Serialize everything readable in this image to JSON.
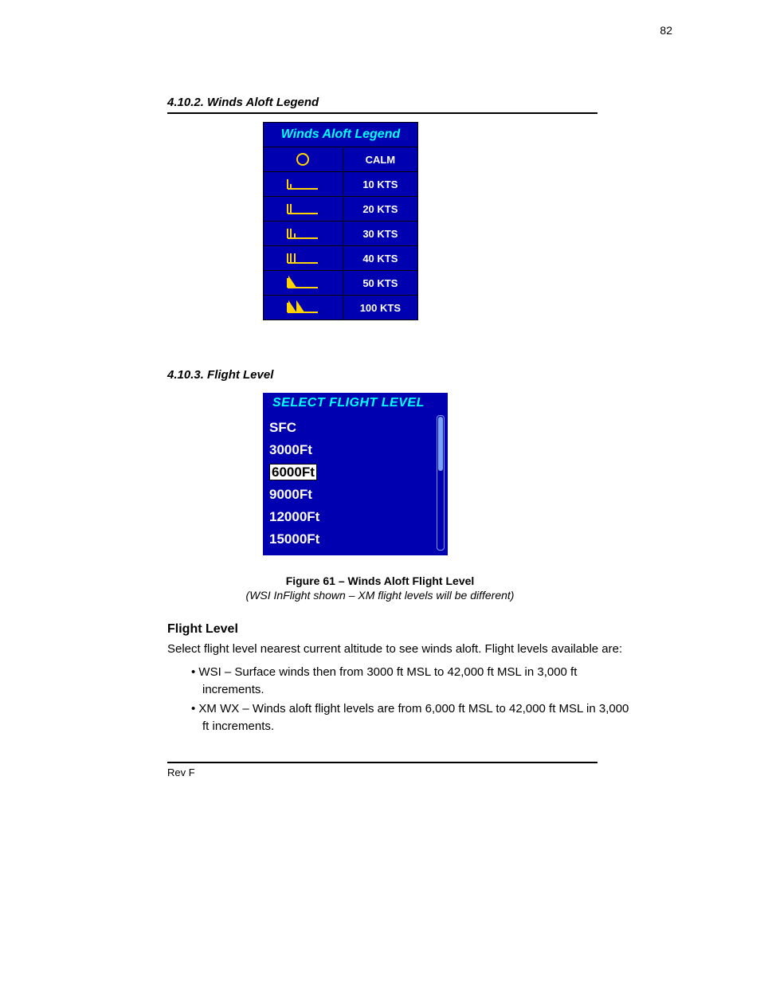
{
  "page_number": "82",
  "section_title_legend": "4.10.2. Winds Aloft Legend",
  "legend": {
    "title": "Winds Aloft Legend",
    "rows": [
      {
        "icon": "calm",
        "label": "CALM"
      },
      {
        "icon": "barb10",
        "label": "10 KTS"
      },
      {
        "icon": "barb20",
        "label": "20 KTS"
      },
      {
        "icon": "barb30",
        "label": "30 KTS"
      },
      {
        "icon": "barb40",
        "label": "40 KTS"
      },
      {
        "icon": "barb50",
        "label": "50 KTS"
      },
      {
        "icon": "barb100",
        "label": "100 KTS"
      }
    ]
  },
  "section_title_level": "4.10.3. Flight Level",
  "flight_level": {
    "title": "SELECT FLIGHT LEVEL",
    "items": [
      "SFC",
      "3000Ft",
      "6000Ft",
      "9000Ft",
      "12000Ft",
      "15000Ft"
    ],
    "selected_index": 2
  },
  "figure_caption": "Figure 61 – Winds Aloft Flight Level",
  "figure_note": "(WSI InFlight shown – XM flight levels will be different)",
  "flight_level_heading": "Flight Level",
  "flight_level_body": "Select flight level nearest current altitude to see winds aloft. Flight levels available are:",
  "bullets": [
    "WSI – Surface winds then from 3000 ft MSL to 42,000 ft MSL in 3,000 ft increments.",
    "XM WX – Winds aloft flight levels are from 6,000 ft MSL to 42,000 ft MSL in 3,000 ft increments."
  ],
  "footer": "Rev F"
}
